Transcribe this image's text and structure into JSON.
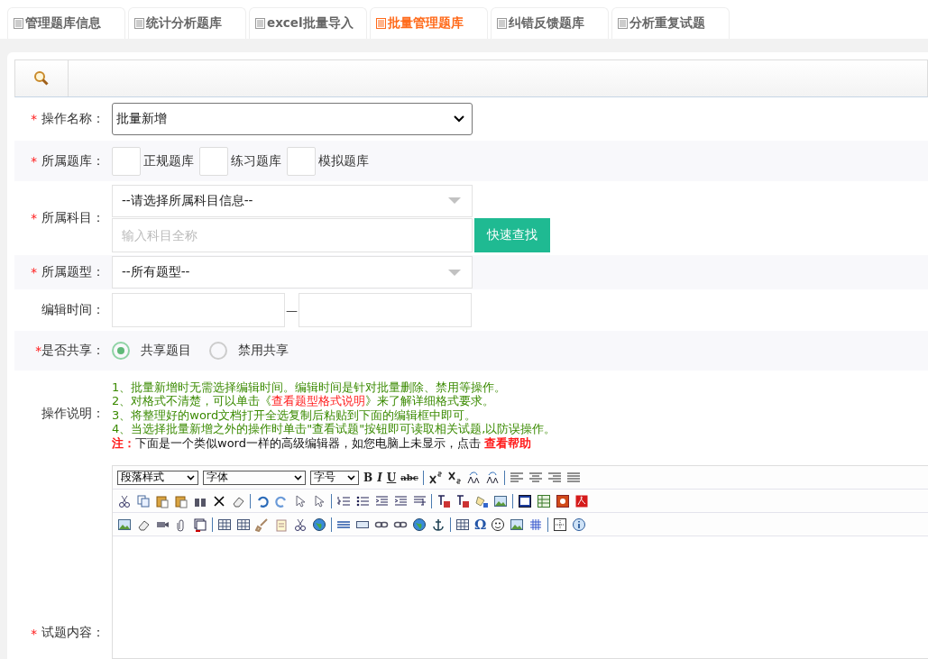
{
  "tabs": [
    {
      "label": "管理题库信息",
      "selected": false
    },
    {
      "label": "统计分析题库",
      "selected": false
    },
    {
      "label": "excel批量导入",
      "selected": false
    },
    {
      "label": "批量管理题库",
      "selected": true
    },
    {
      "label": "纠错反馈题库",
      "selected": false
    },
    {
      "label": "分析重复试题",
      "selected": false
    }
  ],
  "form": {
    "operation": {
      "label": "操作名称：",
      "mark": "*",
      "value": "批量新增"
    },
    "bank": {
      "label": "所属题库：",
      "mark": "*",
      "options": [
        {
          "label": "正规题库",
          "checked": false
        },
        {
          "label": "练习题库",
          "checked": false
        },
        {
          "label": "模拟题库",
          "checked": false
        }
      ]
    },
    "subject": {
      "label": "所属科目：",
      "mark": "*",
      "value": "--请选择所属科目信息--",
      "search_placeholder": "输入科目全称",
      "search_button": "快速查找"
    },
    "type": {
      "label": "所属题型：",
      "mark": "*",
      "value": "--所有题型--"
    },
    "time": {
      "label": "编辑时间：",
      "separator": "—"
    },
    "share": {
      "label": "是否共享：",
      "mark": "*",
      "options": [
        {
          "label": "共享题目",
          "selected": true
        },
        {
          "label": "禁用共享",
          "selected": false
        }
      ]
    },
    "notes": {
      "label": "操作说明：",
      "lines": [
        [
          {
            "kind": "text",
            "text": "1、批量新增时无需选择编辑时间。编辑时间是针对批量删除、禁用等操作。"
          }
        ],
        [
          {
            "kind": "text",
            "text": "2、对格式不清楚，可以单击《"
          },
          {
            "kind": "link",
            "text": "查看题型格式说明"
          },
          {
            "kind": "text",
            "text": "》来了解详细格式要求。"
          }
        ],
        [
          {
            "kind": "text",
            "text": "3、将整理好的word文档打开全选复制后粘贴到下面的编辑框中即可。"
          }
        ],
        [
          {
            "kind": "text",
            "text": "4、当选择批量新增之外的操作时单击\"查看试题\"按钮即可读取相关试题,以防误操作。"
          }
        ],
        [
          {
            "kind": "note",
            "text": "注："
          },
          {
            "kind": "plain",
            "text": "下面是一个类似word一样的高级编辑器，如您电脑上未显示，点击 "
          },
          {
            "kind": "link",
            "text": "查看帮助"
          }
        ]
      ]
    },
    "content": {
      "label": "试题内容：",
      "mark": "*",
      "selects": [
        "段落样式",
        "字体",
        "字号"
      ],
      "format_buttons": [
        "B",
        "I",
        "U",
        "abc"
      ],
      "symbol_button": "Ω"
    }
  }
}
